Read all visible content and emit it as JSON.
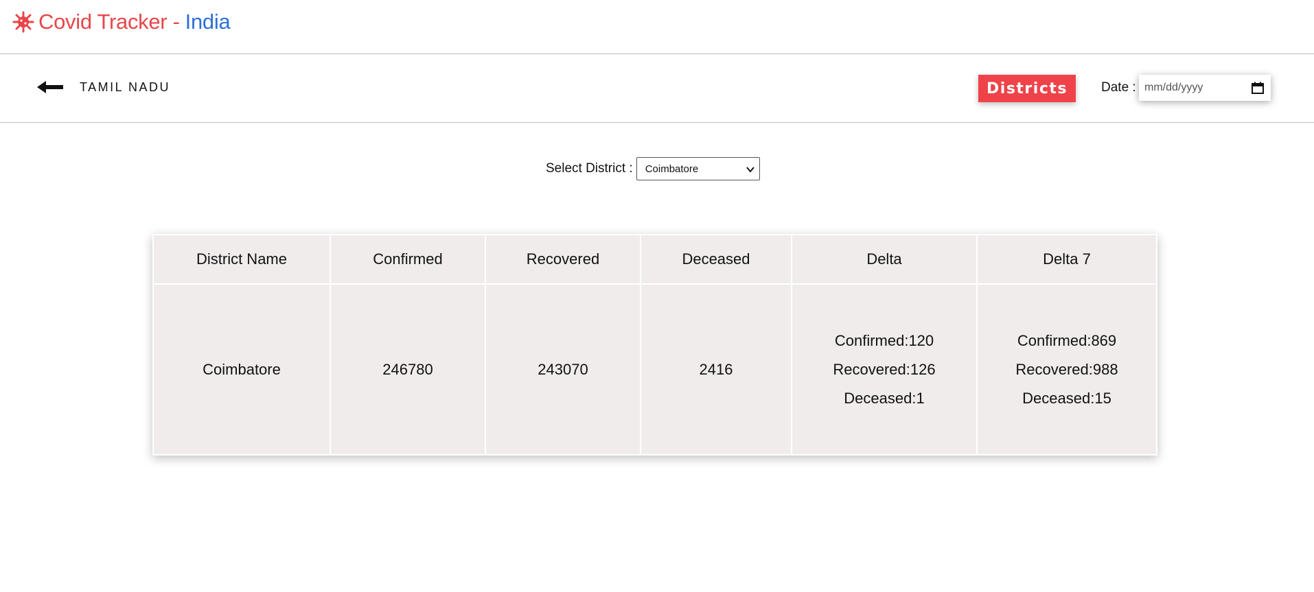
{
  "header": {
    "title_part1": "Covid Tracker -",
    "title_part2": "India",
    "colors": {
      "red": "#e8464a",
      "blue": "#2e6fd6"
    }
  },
  "subheader": {
    "state": "TAMIL NADU",
    "districts_button": "Districts",
    "date_label": "Date :",
    "date_placeholder": "mm/dd/yyyy"
  },
  "district_select": {
    "label": "Select District :",
    "value": "Coimbatore"
  },
  "table": {
    "headers": [
      "District Name",
      "Confirmed",
      "Recovered",
      "Deceased",
      "Delta",
      "Delta 7"
    ],
    "row": {
      "district": "Coimbatore",
      "confirmed": "246780",
      "recovered": "243070",
      "deceased": "2416",
      "delta": [
        "Confirmed:120",
        "Recovered:126",
        "Deceased:1"
      ],
      "delta7": [
        "Confirmed:869",
        "Recovered:988",
        "Deceased:15"
      ]
    }
  }
}
